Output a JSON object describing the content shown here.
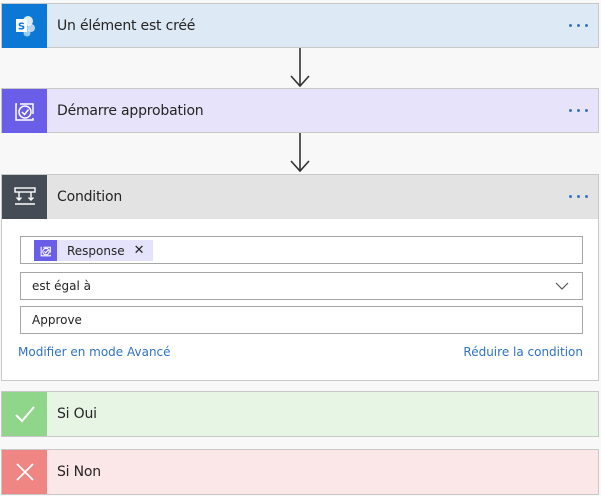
{
  "trigger": {
    "title": "Un élément est créé",
    "icon": "sharepoint-icon",
    "color": "#0a78d4"
  },
  "approval": {
    "title": "Démarre approbation",
    "icon": "approval-icon",
    "color": "#6a5de8"
  },
  "condition": {
    "title": "Condition",
    "icon": "condition-icon",
    "left_operand": "Response",
    "operator": "est égal à",
    "right_operand": "Approve",
    "advanced_link": "Modifier en mode Avancé",
    "collapse_link": "Réduire la condition"
  },
  "if_yes": {
    "title": "Si Oui",
    "icon": "check-icon",
    "color": "#8fd68a"
  },
  "if_no": {
    "title": "Si Non",
    "icon": "close-icon",
    "color": "#ef8684"
  }
}
